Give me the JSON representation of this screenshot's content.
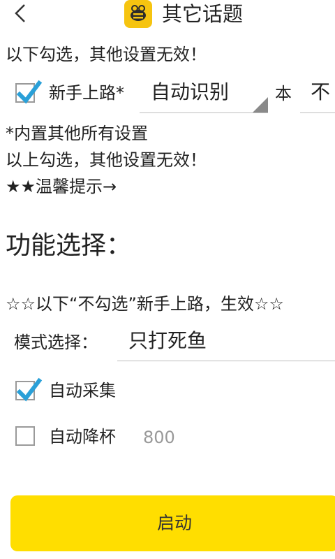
{
  "header": {
    "back_symbol": "<",
    "title": "其它话题"
  },
  "notes": {
    "below_note": "以下勾选，其他设置无效！",
    "builtin_note": "*内置其他所有设置",
    "above_note": "以上勾选，其他设置无效！",
    "tips": "★★温馨提示→"
  },
  "newbie": {
    "label": "新手上路*",
    "checked": true,
    "mode_value": "自动识别",
    "ben_label": "本",
    "ben_value": "不"
  },
  "function_section": {
    "title": "功能选择：",
    "uncheck_note": "☆☆以下“不勾选”新手上路，生效☆☆",
    "mode_label": "模式选择：",
    "mode_value": "只打死鱼"
  },
  "options": {
    "auto_collect": {
      "label": "自动采集",
      "checked": true
    },
    "auto_cup": {
      "label": "自动降杯",
      "checked": false,
      "value": "800"
    }
  },
  "start_button": {
    "label": "启动"
  },
  "colors": {
    "accent": "#ffde00",
    "check": "#2aa0d8",
    "logo": "#f6c410"
  },
  "icons": {
    "back": "chevron-left-icon",
    "logo": "bee-logo-icon",
    "check": "checkmark-icon"
  }
}
